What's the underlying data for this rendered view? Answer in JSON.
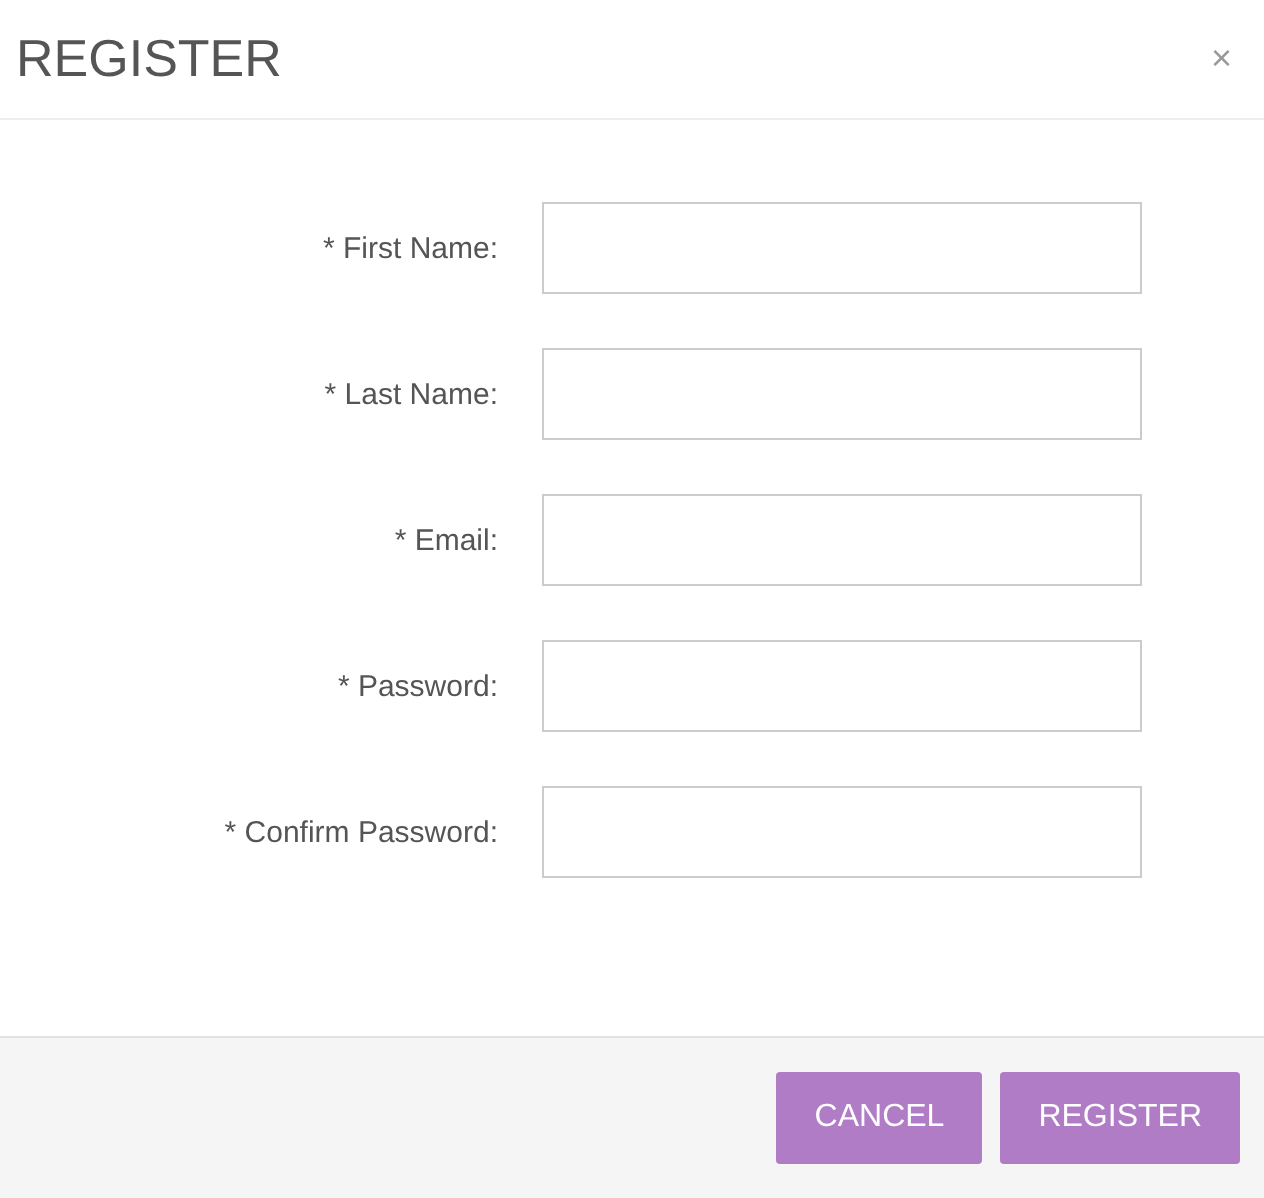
{
  "dialog": {
    "title": "REGISTER",
    "close": "×"
  },
  "fields": [
    {
      "label": "* First Name:"
    },
    {
      "label": "* Last Name:"
    },
    {
      "label": "* Email:"
    },
    {
      "label": "* Password:"
    },
    {
      "label": "* Confirm Password:"
    }
  ],
  "buttons": [
    {
      "label": "CANCEL"
    },
    {
      "label": "REGISTER"
    }
  ]
}
